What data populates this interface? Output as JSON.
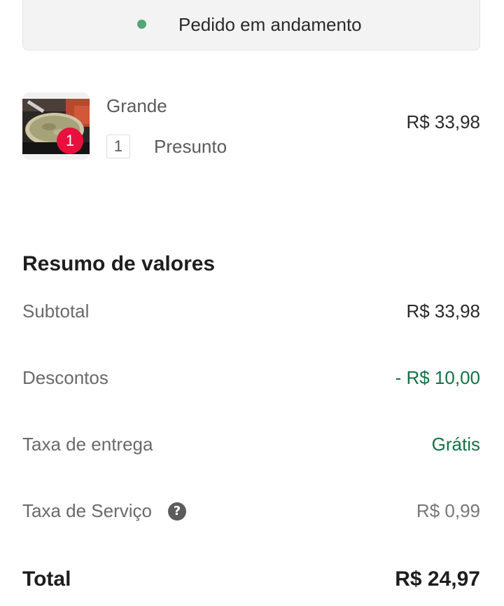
{
  "order_status": {
    "text": "Pedido em andamento",
    "dot_color": "#50a773"
  },
  "item": {
    "image": "pizza-photo",
    "quantity": "1",
    "size": "Grande",
    "price": "R$ 33,98",
    "addon": {
      "quantity": "1",
      "name": "Presunto"
    }
  },
  "summary": {
    "title": "Resumo de valores",
    "rows": [
      {
        "label": "Subtotal",
        "value": "R$ 33,98"
      },
      {
        "label": "Descontos",
        "value": "- R$ 10,00",
        "color": "#157145"
      },
      {
        "label": "Taxa de entrega",
        "value": "Grátis",
        "color": "#157145"
      },
      {
        "label": "Taxa de Serviço",
        "value": "R$ 0,99",
        "help_icon": "question-icon"
      }
    ],
    "total_label": "Total",
    "total_value": "R$ 24,97"
  }
}
